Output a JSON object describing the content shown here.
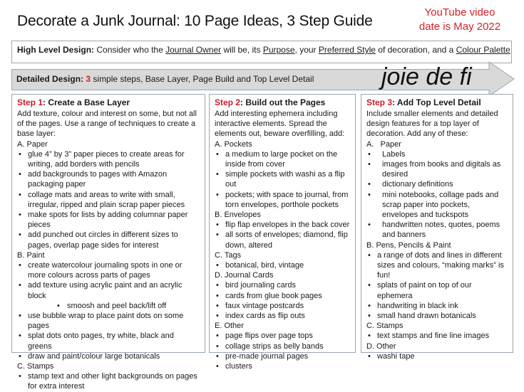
{
  "title": "Decorate a Junk Journal: 10 Page Ideas, 3 Step Guide",
  "youtube_note": [
    "YouTube video",
    "date is May 2022"
  ],
  "colors": {
    "accent_red": "#d4212a",
    "box_border": "#9aa6b2",
    "arrow_fill": "#d9d9d9"
  },
  "high_level": {
    "label": "High Level Design:",
    "t1": " Consider who the ",
    "u1": "Journal Owner",
    "t2": " will be, its ",
    "u2": "Purpose",
    "t3": ", your ",
    "u3": "Preferred Style",
    "t4": " of decoration, and a ",
    "u4": "Colour Palette"
  },
  "detailed": {
    "label": "Detailed Design:",
    "number": "3",
    "text": " simple steps, Base Layer, Page Build and Top Level Detail",
    "watermark": "joie de fi"
  },
  "steps": [
    {
      "num": "Step 1",
      "title": ": Create a Base Layer",
      "intro": "Add texture, colour and interest on some, but not all of the pages. Use a range of techniques to create a base layer:",
      "sections": [
        {
          "heading": "A. Paper",
          "items": [
            "glue 4” by 3” paper pieces to create areas for writing, add borders with pencils",
            "add backgrounds to pages with Amazon packaging paper",
            "collage mats and areas to write with small, irregular, ripped and plain scrap paper pieces",
            "make spots for lists by adding columnar paper pieces",
            "add punched out circles in different sizes to pages, overlap page sides for interest"
          ]
        },
        {
          "heading": "B. Paint",
          "items": [
            "create watercolour journaling spots in one or more colours across parts of pages",
            "add texture using acrylic paint and an acrylic block",
            "smoosh and peel back/lift off",
            "use bubble wrap to place paint dots on some pages",
            "splat dots onto pages, try white, black and greens",
            "draw and paint/colour large botanicals"
          ]
        },
        {
          "heading": "C. Stamps",
          "items": [
            "stamp text and other light backgrounds on pages for extra interest"
          ]
        }
      ]
    },
    {
      "num": "Step 2",
      "title": ": Build out the Pages",
      "intro": "Add interesting ephemera including interactive elements. Spread the elements out, beware overfilling, add:",
      "sections": [
        {
          "heading": "A. Pockets",
          "items": [
            "a medium to large pocket on the inside from cover",
            "simple pockets with washi as a flip out",
            "pockets; with space to journal, from torn envelopes, porthole pockets"
          ]
        },
        {
          "heading": "B. Envelopes",
          "items": [
            "flip flap envelopes in the back cover",
            "all sorts of envelopes; diamond, flip down, altered"
          ]
        },
        {
          "heading": "C. Tags",
          "items": [
            "botanical, bird, vintage"
          ]
        },
        {
          "heading": "D. Journal Cards",
          "items": [
            "bird journaling cards",
            "cards from glue book pages",
            "faux vintage postcards",
            "index cards as flip outs"
          ]
        },
        {
          "heading": "E. Other",
          "items": [
            "page flips over page tops",
            "collage strips as belly bands",
            "pre-made journal pages",
            "clusters"
          ]
        }
      ]
    },
    {
      "num": "Step 3",
      "title": ": Add Top Level Detail",
      "intro": "Include smaller elements and detailed design features for a top layer of decoration. Add any of these:",
      "sections": [
        {
          "heading": "A.   Paper",
          "items": [
            "Labels",
            "images from books and digitals as desired",
            "dictionary definitions",
            "mini notebooks, collage pads and scrap paper into pockets, envelopes and tuckspots",
            "handwritten notes, quotes, poems and banners"
          ]
        },
        {
          "heading": "B. Pens, Pencils & Paint",
          "items": [
            "a range of dots and lines in different sizes and colours, “making marks” is fun!",
            "splats of paint on top of our ephemera",
            "handwriting in black ink",
            "small hand drawn botanicals"
          ]
        },
        {
          "heading": "C. Stamps",
          "items": [
            "text stamps and fine line images"
          ]
        },
        {
          "heading": "D. Other",
          "items": [
            "washi tape"
          ]
        }
      ]
    }
  ]
}
